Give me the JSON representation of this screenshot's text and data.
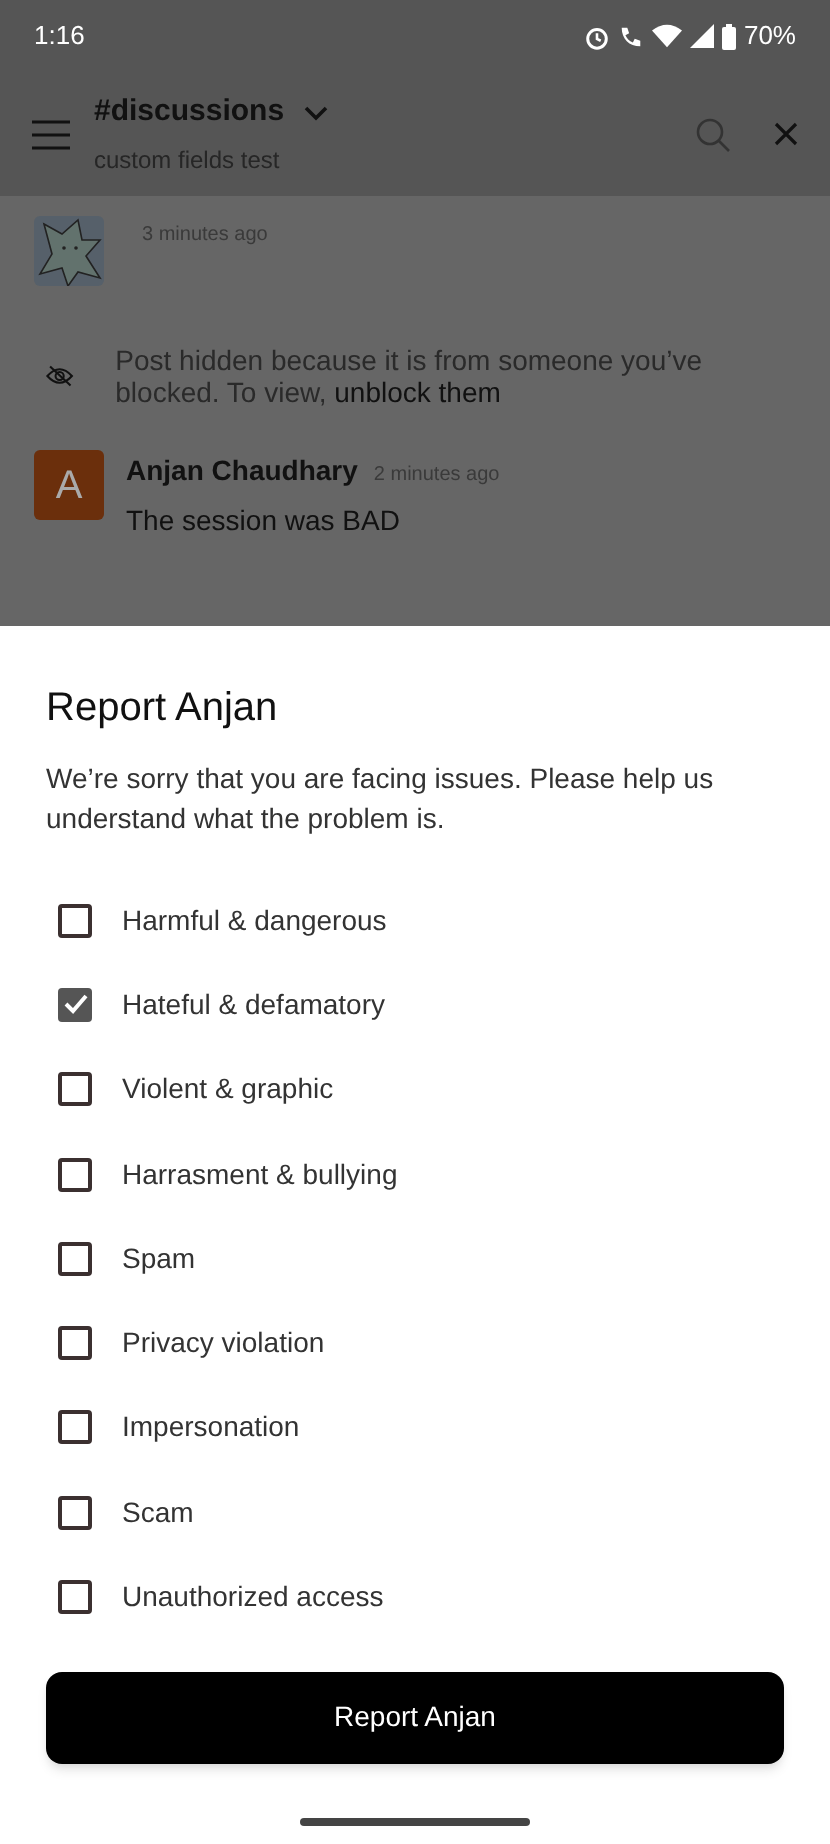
{
  "status_bar": {
    "time": "1:16",
    "battery": "70%"
  },
  "header": {
    "channel": "#discussions",
    "subtitle": "custom fields test"
  },
  "messages": [
    {
      "kind": "avatar_only",
      "time": "3 minutes ago"
    },
    {
      "kind": "hidden",
      "text": "Post hidden because it is from someone you’ve blocked. To view, **unblock them**"
    },
    {
      "kind": "post",
      "initial": "A",
      "author": "Anjan Chaudhary",
      "time": "2 minutes ago",
      "text": "The session was BAD"
    }
  ],
  "sheet": {
    "title": "Report Anjan",
    "description": "We’re sorry that you are facing issues. Please help us understand what the problem is.",
    "options": [
      {
        "label": "Harmful & dangerous",
        "checked": false
      },
      {
        "label": "Hateful & defamatory",
        "checked": true
      },
      {
        "label": "Violent & graphic",
        "checked": false
      },
      {
        "label": "Harrasment & bullying",
        "checked": false
      },
      {
        "label": "Spam",
        "checked": false
      },
      {
        "label": "Privacy violation",
        "checked": false
      },
      {
        "label": "Impersonation",
        "checked": false
      },
      {
        "label": "Scam",
        "checked": false
      },
      {
        "label": "Unauthorized access",
        "checked": false
      }
    ],
    "button": "Report Anjan"
  }
}
